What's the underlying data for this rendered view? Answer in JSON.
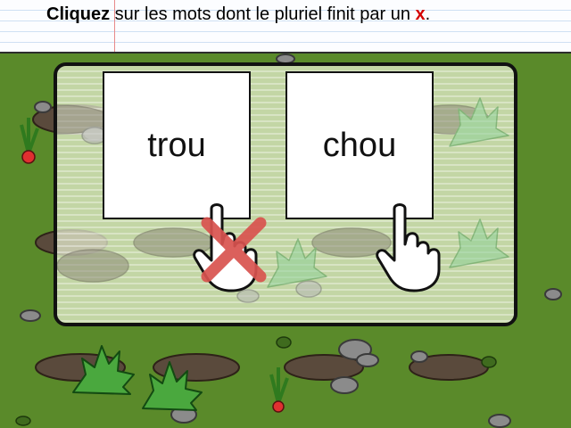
{
  "instruction": {
    "lead_bold": "Cliquez",
    "text": " sur les mots dont le pluriel finit par un ",
    "highlight": "x",
    "end": "."
  },
  "words": [
    {
      "label": "trou",
      "state": "wrong"
    },
    {
      "label": "chou",
      "state": "unanswered"
    }
  ],
  "icons": {
    "pointer": "pointing-hand-icon",
    "wrong_mark": "red-x-icon"
  },
  "colors": {
    "highlight": "#d40000",
    "wrong_mark": "#d9534f",
    "grass": "#5a8a2a",
    "panel_border": "#111111"
  }
}
